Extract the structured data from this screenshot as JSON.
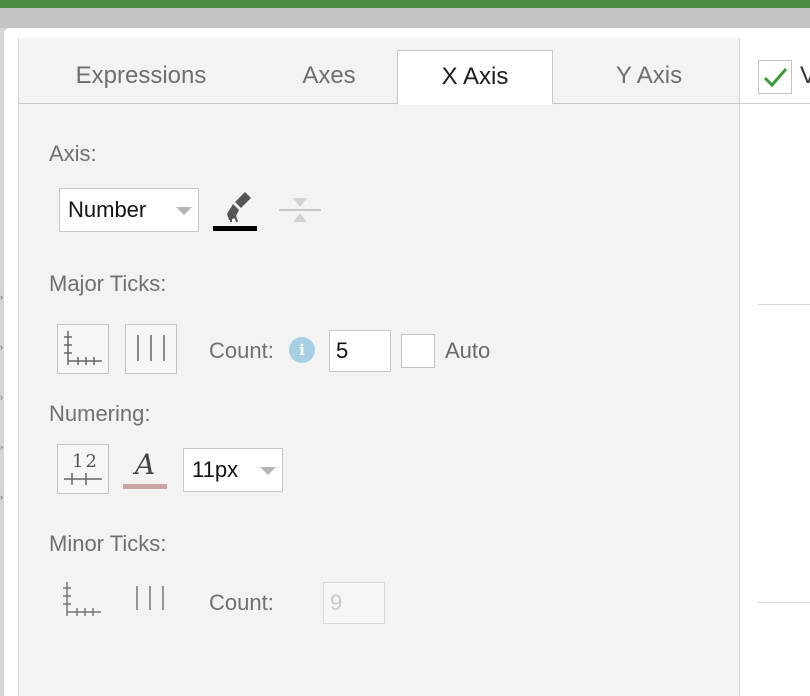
{
  "tabs": [
    {
      "label": "Expressions",
      "active": false
    },
    {
      "label": "Axes",
      "active": false
    },
    {
      "label": "X Axis",
      "active": true
    },
    {
      "label": "Y Axis",
      "active": false
    }
  ],
  "axis": {
    "label": "Axis:",
    "type_value": "Number",
    "style_icon": "brush-color-icon",
    "style_color": "#000000",
    "position_icon": "axis-position-icon"
  },
  "major_ticks": {
    "label": "Major Ticks:",
    "count_label": "Count:",
    "count_value": "5",
    "auto_label": "Auto",
    "auto_checked": false
  },
  "numbering": {
    "label": "Numering:",
    "number_icon_text": "12",
    "font_icon_text": "A",
    "font_color": "#c9a6a2",
    "size_value": "11px"
  },
  "minor_ticks": {
    "label": "Minor Ticks:",
    "count_label": "Count:",
    "count_value": "9"
  },
  "right_panel": {
    "checkbox_checked": true,
    "checkbox_label": "V"
  },
  "colors": {
    "topbar": "#4b8a3f",
    "check": "#3c9a3c",
    "info": "#a6cfe3"
  }
}
